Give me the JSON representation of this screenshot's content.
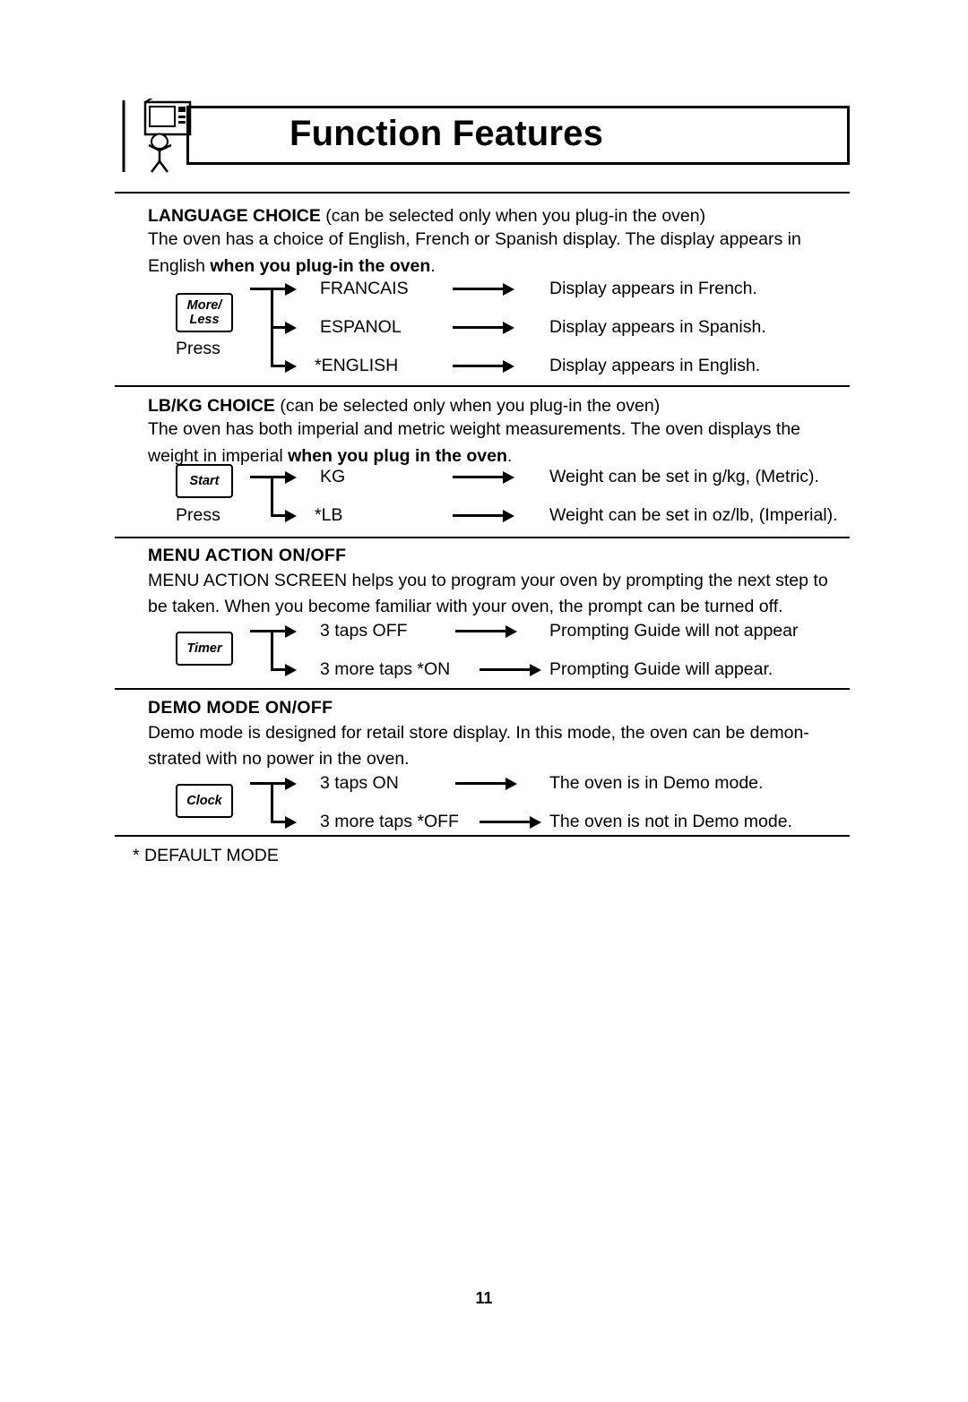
{
  "header": {
    "title": "Function Features",
    "icon": "oven-chef-icon"
  },
  "sections": [
    {
      "id": "language-choice",
      "heading": "LANGUAGE CHOICE",
      "heading_suffix": " (can be selected only when you plug-in the oven)",
      "body_line1": "The oven has a choice of English, French or Spanish display. The display appears in",
      "body_line2_plain": "English ",
      "body_line2_bold": "when you plug-in the oven",
      "body_line2_tail": ".",
      "key_label_line1": "More/",
      "key_label_line2": "Less",
      "press_label": "Press",
      "rows": [
        {
          "option": "FRANCAIS",
          "result": "Display appears in French."
        },
        {
          "option": "ESPANOL",
          "result": "Display appears in Spanish."
        },
        {
          "option": "*ENGLISH",
          "result": "Display appears in English."
        }
      ]
    },
    {
      "id": "lb-kg-choice",
      "heading": "LB/KG CHOICE",
      "heading_suffix": " (can be selected only when you plug-in the oven)",
      "body_line1": "The oven has both imperial and metric weight measurements. The oven displays the",
      "body_line2_plain": "weight in imperial ",
      "body_line2_bold": "when you plug in the oven",
      "body_line2_tail": ".",
      "key_label_line1": "Start",
      "key_label_line2": "",
      "press_label": "Press",
      "rows": [
        {
          "option": "KG",
          "result": "Weight can be set in g/kg, (Metric)."
        },
        {
          "option": "*LB",
          "result": "Weight can be set in oz/lb, (Imperial)."
        }
      ]
    },
    {
      "id": "menu-action-on-off",
      "heading": "MENU ACTION ON/OFF",
      "heading_suffix": "",
      "body_line1": "MENU ACTION SCREEN helps you to program your oven by prompting the next step to",
      "body_line2_plain": "be taken. When you become familiar with your oven, the prompt can be turned off.",
      "body_line2_bold": "",
      "body_line2_tail": "",
      "key_label_line1": "Timer",
      "key_label_line2": "",
      "press_label": "",
      "rows": [
        {
          "option": "3 taps OFF",
          "result": "Prompting Guide will not appear"
        },
        {
          "option": "3 more taps *ON",
          "result": "Prompting Guide will appear."
        }
      ]
    },
    {
      "id": "demo-mode-on-off",
      "heading": "DEMO MODE ON/OFF",
      "heading_suffix": "",
      "body_line1": "Demo mode is designed for retail store display. In this mode, the oven can be demon-",
      "body_line2_plain": "strated with no power in the oven.",
      "body_line2_bold": "",
      "body_line2_tail": "",
      "key_label_line1": "Clock",
      "key_label_line2": "",
      "press_label": "",
      "rows": [
        {
          "option": "3 taps ON",
          "result": "The oven is in Demo mode."
        },
        {
          "option": "3 more taps *OFF",
          "result": "The oven is not in Demo mode."
        }
      ]
    }
  ],
  "footer_note": "* DEFAULT MODE",
  "page_number": "11"
}
